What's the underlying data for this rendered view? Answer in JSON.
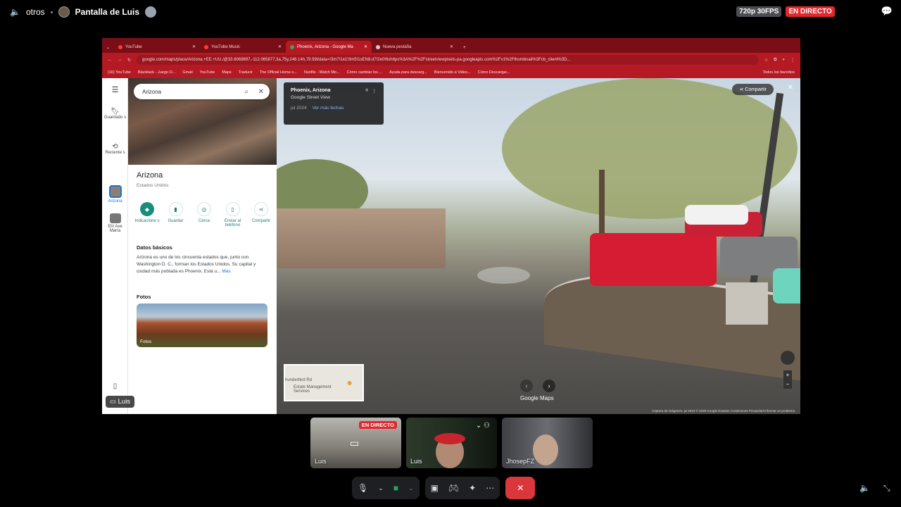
{
  "topbar": {
    "channel": "otros",
    "screen_title": "Pantalla de Luis",
    "quality": "720p 30FPS",
    "live": "EN DIRECTO"
  },
  "browser": {
    "tabs": [
      {
        "label": "YouTube",
        "active": false
      },
      {
        "label": "YouTube Music",
        "active": false
      },
      {
        "label": "Phoenix, Arizona - Google Ma",
        "active": true
      },
      {
        "label": "Nueva pestaña",
        "active": false
      }
    ],
    "url": "google.com/maps/place/Arizona,+EE.+UU./@33.6069897,-112.065877,3a,75y,248.14h,79.59t/data=!3m7!1e1!3m5!1sEN8.d7!2e0!6shttps%3A%2F%2Fstreetviewpixels-pa.googleapis.com%2Fv1%2Fthumbnail%3Fcb_client%3D...",
    "bookmarks": [
      "(16) YouTube",
      "Blacklack - Juego O...",
      "Gmail",
      "YouTube",
      "Maps",
      "Traducir",
      "The Official Home o...",
      "Nunflix - Watch Mo...",
      "Cómo cambiar los ...",
      "Ayuda para descarg...",
      "Bienvenido a Video...",
      "Cómo Descargar..."
    ],
    "bookmarks_right": "Todos los favoritos"
  },
  "maps": {
    "rail": [
      {
        "label": "Guardado s"
      },
      {
        "label": "Reciente s"
      },
      {
        "label": "Arizona"
      },
      {
        "label": "Eh! Ave María"
      }
    ],
    "search_value": "Arizona",
    "place_title": "Arizona",
    "place_sub": "Estados Unidos",
    "actions": [
      {
        "label": "Indicacione s",
        "icon": "directions-icon"
      },
      {
        "label": "Guardar",
        "icon": "bookmark-icon"
      },
      {
        "label": "Cerca",
        "icon": "nearby-icon"
      },
      {
        "label": "Enviar al teléfono",
        "icon": "phone-icon"
      },
      {
        "label": "Compartir",
        "icon": "share-icon"
      }
    ],
    "basics_title": "Datos básicos",
    "basics_text": "Arizona es uno de los cincuenta estados que, junto con Washington D. C., forman los Estados Unidos. Su capital y ciudad más poblada es Phoenix. Está u...",
    "basics_more": "Más",
    "photos_title": "Fotos",
    "photo_label": "Fotos"
  },
  "streetview": {
    "place": "Phoenix, Arizona",
    "source": "Google Street View",
    "date": "jul 2024",
    "more_dates": "Ver más fechas",
    "share": "Compartir",
    "minimap_road": "hunderbird Rd",
    "minimap_poi": "Estate Management Services",
    "brand": "Google Maps",
    "footer": "Captura de imágenes: jul 2024   © 2025 Google   Estados   Condiciones   Privacidad   Informar un problema"
  },
  "presenter_label": "Luis",
  "participants": [
    {
      "name": "Luis",
      "live": "EN DIRECTO"
    },
    {
      "name": "Luis"
    },
    {
      "name": "JhosepFZ"
    }
  ]
}
